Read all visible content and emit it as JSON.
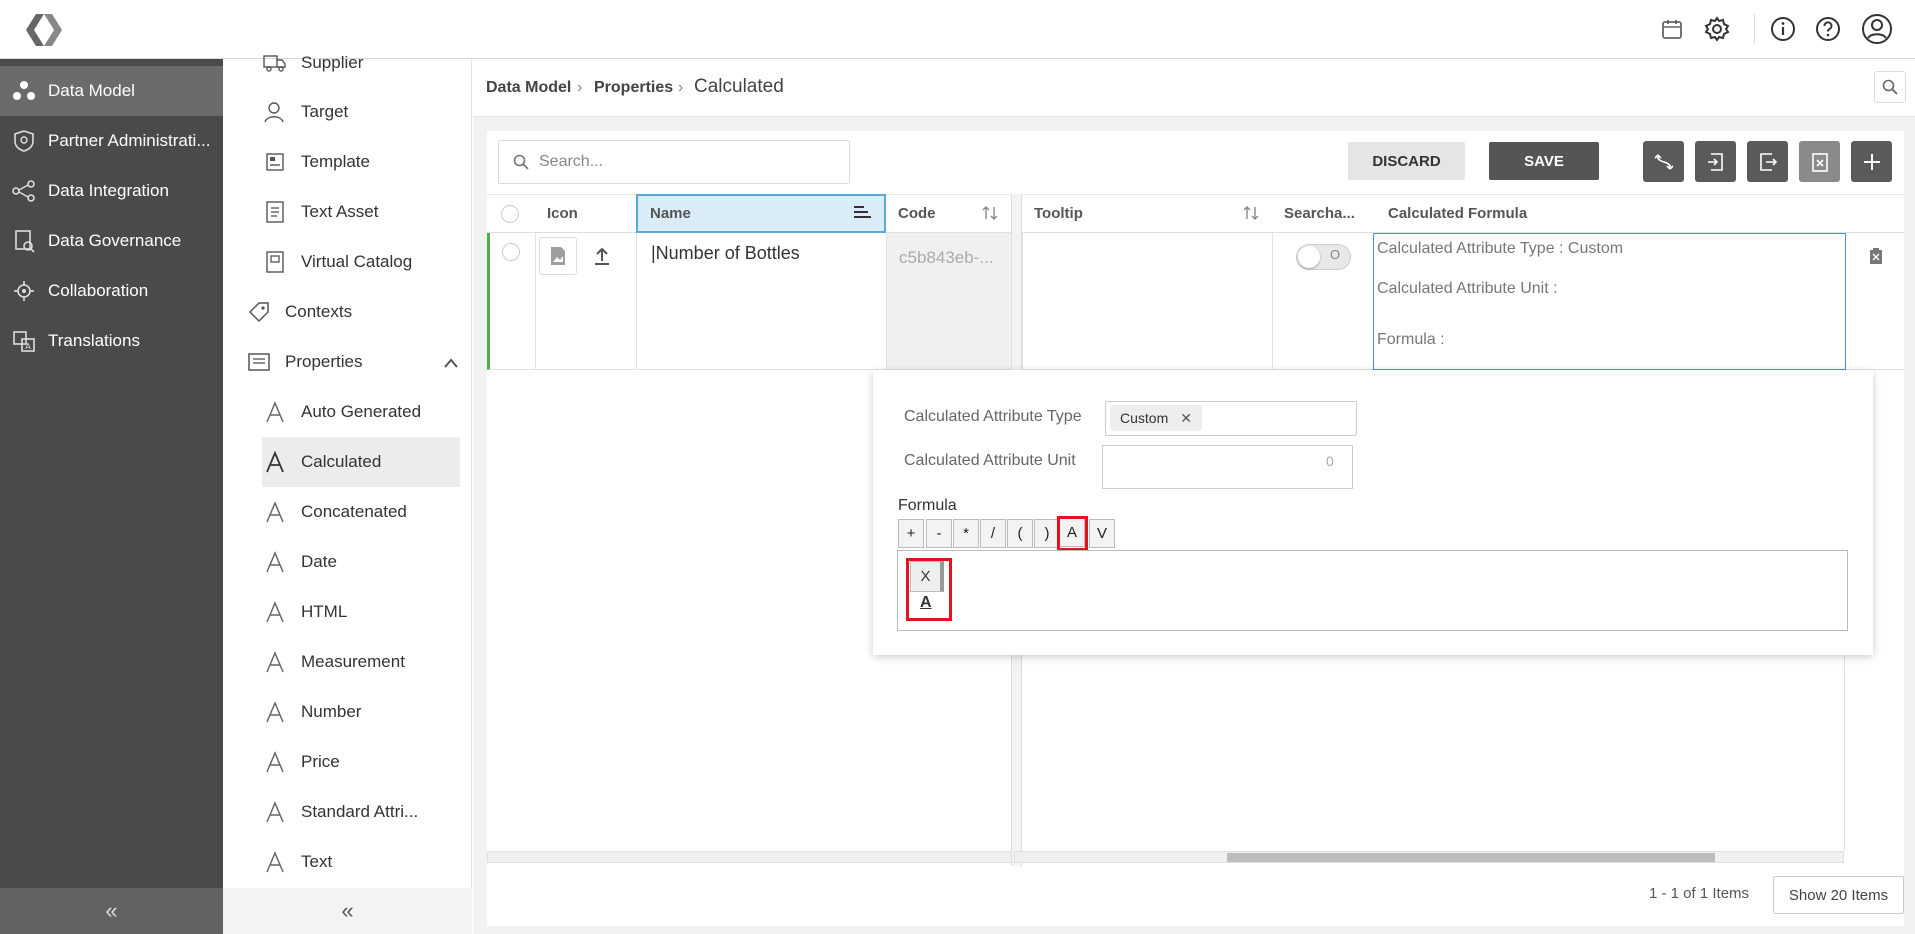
{
  "topbar": {
    "icons": [
      "calendar-icon",
      "gear-icon",
      "info-icon",
      "help-icon",
      "user-avatar-icon"
    ]
  },
  "leftnav": {
    "items": [
      {
        "label": "Data Model",
        "icon": "data-model-icon",
        "active": true
      },
      {
        "label": "Partner Administrati...",
        "icon": "shield-icon",
        "active": false
      },
      {
        "label": "Data Integration",
        "icon": "integration-icon",
        "active": false
      },
      {
        "label": "Data Governance",
        "icon": "governance-icon",
        "active": false
      },
      {
        "label": "Collaboration",
        "icon": "collaboration-icon",
        "active": false
      },
      {
        "label": "Translations",
        "icon": "translations-icon",
        "active": false
      }
    ],
    "collapse": "«"
  },
  "subnav": {
    "items": [
      {
        "label": "Supplier"
      },
      {
        "label": "Target"
      },
      {
        "label": "Template"
      },
      {
        "label": "Text Asset"
      },
      {
        "label": "Virtual Catalog"
      },
      {
        "label": "Contexts"
      },
      {
        "label": "Properties"
      },
      {
        "label": "Auto Generated"
      },
      {
        "label": "Calculated"
      },
      {
        "label": "Concatenated"
      },
      {
        "label": "Date"
      },
      {
        "label": "HTML"
      },
      {
        "label": "Measurement"
      },
      {
        "label": "Number"
      },
      {
        "label": "Price"
      },
      {
        "label": "Standard Attri..."
      },
      {
        "label": "Text"
      }
    ],
    "collapse": "«"
  },
  "breadcrumb": {
    "first": "Data Model",
    "second": "Properties",
    "current": "Calculated",
    "sep": "›"
  },
  "toolbar": {
    "search_placeholder": "Search...",
    "discard_label": "DISCARD",
    "save_label": "SAVE"
  },
  "grid": {
    "headers": {
      "icon": "Icon",
      "name": "Name",
      "code": "Code",
      "tooltip": "Tooltip",
      "searchable": "Searcha...",
      "formula": "Calculated Formula"
    },
    "row": {
      "name": "|Number of Bottles",
      "code": "c5b843eb-...",
      "toggle_label": "O",
      "formula_type": "Calculated Attribute Type : Custom",
      "formula_unit": "Calculated Attribute Unit :",
      "formula_formula": "Formula :"
    }
  },
  "editor": {
    "type_label": "Calculated Attribute Type",
    "type_value": "Custom",
    "unit_label": "Calculated Attribute Unit",
    "unit_count": "0",
    "formula_label": "Formula",
    "operators": [
      "+",
      "-",
      "*",
      "/",
      "(",
      ")",
      "A",
      "V"
    ],
    "token_remove": "X",
    "token_attr": "A"
  },
  "footer": {
    "paging": "1 - 1 of 1 Items",
    "show_label": "Show 20 Items"
  },
  "colors": {
    "highlight": "#e0141e",
    "nav_bg": "#4a4a4a",
    "accent_blue": "#5aa7dd"
  }
}
